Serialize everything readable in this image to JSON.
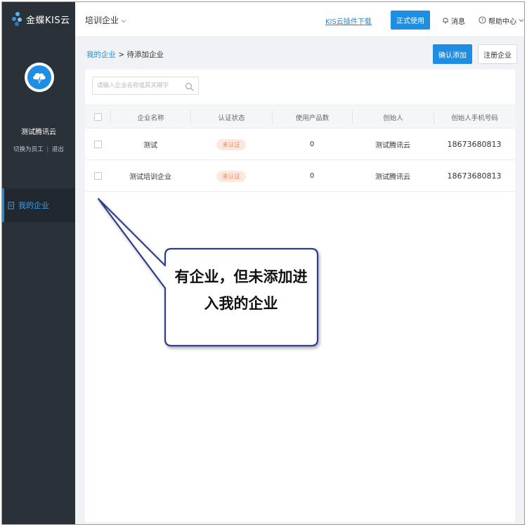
{
  "brand": {
    "name": "金蝶KIS云"
  },
  "user": {
    "name": "测试腾讯云",
    "switch_label": "切换为员工",
    "separator": "|",
    "logout_label": "退出"
  },
  "sidebar": {
    "items": [
      {
        "label": "我的企业",
        "active": true
      }
    ]
  },
  "topbar": {
    "company": "培训企业",
    "plugin_link": "KIS云插件下载",
    "formal_use_button": "正式使用",
    "messages": "消息",
    "help_center": "帮助中心"
  },
  "breadcrumb": {
    "root": "我的企业",
    "separator": ">",
    "current": "待添加企业"
  },
  "actions": {
    "confirm_add": "确认添加",
    "register_company": "注册企业"
  },
  "search": {
    "placeholder": "请输入企业名称或其关键字",
    "value": ""
  },
  "table": {
    "columns": [
      "企业名称",
      "认证状态",
      "使用产品数",
      "创始人",
      "创始人手机号码"
    ],
    "rows": [
      {
        "name": "测试",
        "status": "未认证",
        "products": "0",
        "founder": "测试腾讯云",
        "phone": "18673680813"
      },
      {
        "name": "测试培训企业",
        "status": "未认证",
        "products": "0",
        "founder": "测试腾讯云",
        "phone": "18673680813"
      }
    ]
  },
  "annotation": {
    "line1": "有企业，但未添加进",
    "line2": "入我的企业"
  },
  "colors": {
    "primary": "#1e8ee3",
    "sidebar": "#2b3139",
    "badge_bg": "#fde8df",
    "badge_text": "#f08a5d",
    "callout_border": "#2e3d8f"
  }
}
